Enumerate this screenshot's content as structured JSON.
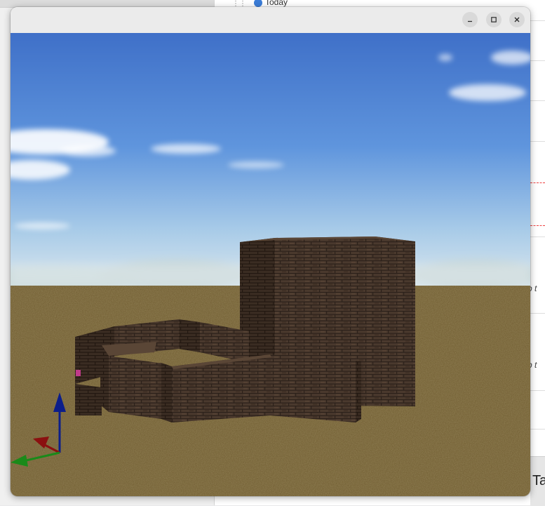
{
  "background_app": {
    "today_label": "Today",
    "fragment_1": "b t",
    "fragment_2": "b t",
    "bottom_fragment": "Ta"
  },
  "window": {
    "controls": {
      "minimize": "minimize",
      "maximize": "maximize",
      "close": "close"
    }
  },
  "scene": {
    "sky_top_color": "#3f70c8",
    "sky_horizon_color": "#d9e6ee",
    "ground_color": "#6e5a2e",
    "wall_color": "#4a392d",
    "mortar_color": "#2c211a",
    "floor_color": "#6f5238",
    "axes": {
      "x_color": "#1a8a1a",
      "y_color": "#8b1010",
      "z_color": "#0c1e8a"
    }
  }
}
